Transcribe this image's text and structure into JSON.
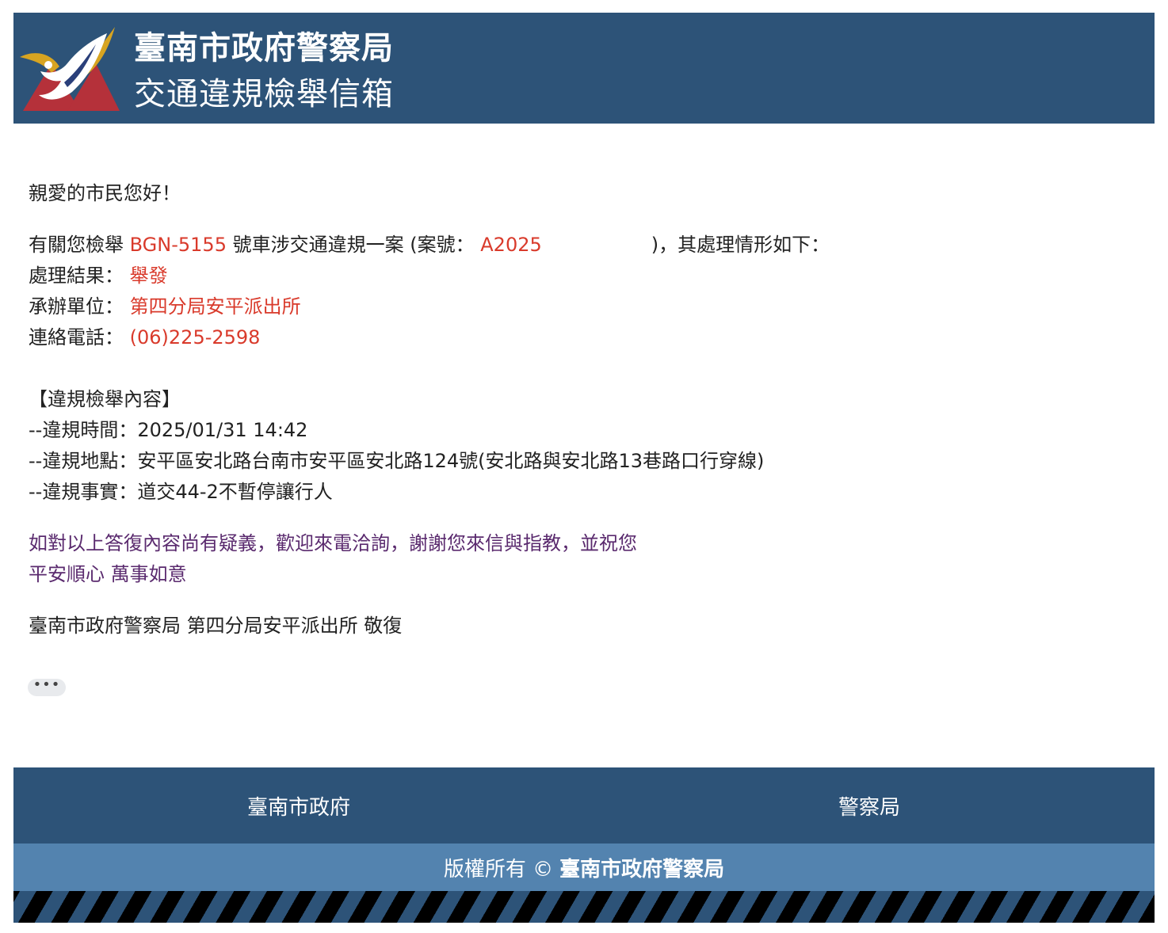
{
  "header": {
    "title": "臺南市政府警察局",
    "subtitle": "交通違規檢舉信箱"
  },
  "letter": {
    "greeting": "親愛的市民您好！",
    "intro_prefix": "有關您檢舉",
    "plate": "BGN-5155",
    "intro_mid": "號車涉交通違規一案 (案號：",
    "case_no": "A2025",
    "intro_suffix": ")，其處理情形如下：",
    "result_label": "處理結果：",
    "result_value": "舉發",
    "unit_label": "承辦單位：",
    "unit_value": "第四分局安平派出所",
    "phone_label": "連絡電話：",
    "phone_value": "(06)225-2598",
    "section_title": "【違規檢舉內容】",
    "time_line": "--違規時間：2025/01/31 14:42",
    "place_line": "--違規地點：安平區安北路台南市安平區安北路124號(安北路與安北路13巷路口行穿線)",
    "fact_line": "--違規事實：道交44-2不暫停讓行人",
    "closing1": "如對以上答復內容尚有疑義，歡迎來電洽詢，謝謝您來信與指教，並祝您",
    "closing2": "平安順心 萬事如意",
    "signature": "臺南市政府警察局 第四分局安平派出所 敬復"
  },
  "more_button": "•••",
  "footer": {
    "link_city": "臺南市政府",
    "link_police": "警察局",
    "copyright_prefix": "版權所有 ©",
    "copyright_org": "臺南市政府警察局"
  },
  "colors": {
    "header_bg": "#2d5378",
    "copyright_bg": "#5383af",
    "highlight": "#d93a2b",
    "closing_text": "#5a2a6e"
  }
}
